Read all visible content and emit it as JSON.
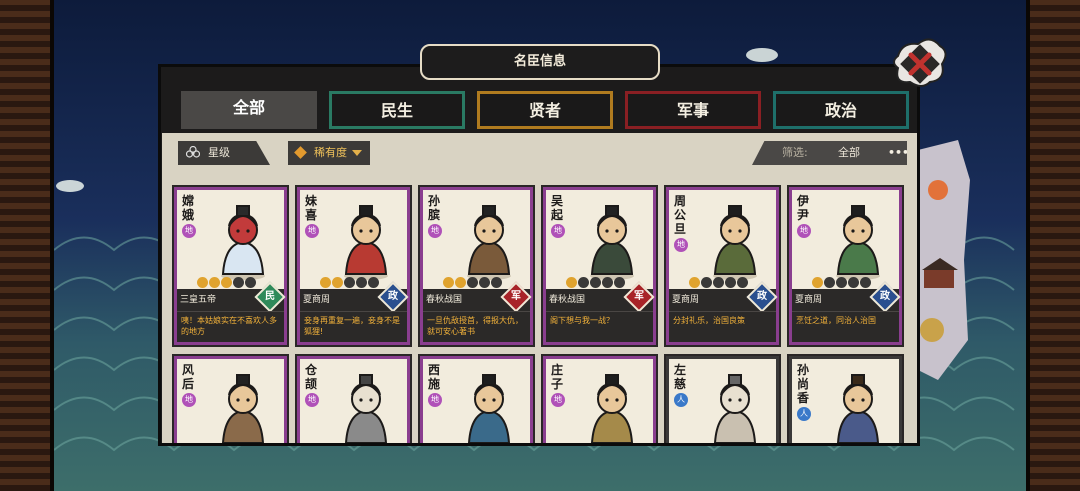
{
  "window": {
    "title": "名臣信息"
  },
  "tabs": [
    {
      "label": "全部",
      "active": true
    },
    {
      "label": "民生",
      "active": false
    },
    {
      "label": "贤者",
      "active": false
    },
    {
      "label": "军事",
      "active": false
    },
    {
      "label": "政治",
      "active": false
    }
  ],
  "filters": {
    "star_label": "星级",
    "rarity_label": "稀有度",
    "screen_label": "筛选:",
    "screen_value": "全部",
    "more": "•••"
  },
  "colors": {
    "minsheng": "#2f8a5a",
    "zhengzhi": "#2a4f8f",
    "junshi": "#a82328",
    "tier_di": "#b051b8",
    "tier_ren": "#3a79c9"
  },
  "cards": [
    {
      "name": "嫦娥",
      "tier": "地",
      "stars": 3,
      "era": "三皇五帝",
      "type": "民",
      "type_color": "#2f8a5a",
      "quote": "咦！本姑娘实在不喜欢人多的地方"
    },
    {
      "name": "妹喜",
      "tier": "地",
      "stars": 2,
      "era": "夏商周",
      "type": "政",
      "type_color": "#2a4f8f",
      "quote": "妾身再重复一遍，妾身不是狐狸!"
    },
    {
      "name": "孙膑",
      "tier": "地",
      "stars": 2,
      "era": "春秋战国",
      "type": "军",
      "type_color": "#a82328",
      "quote": "一旦仇敌授首，得报大仇，就可安心著书"
    },
    {
      "name": "吴起",
      "tier": "地",
      "stars": 1,
      "era": "春秋战国",
      "type": "军",
      "type_color": "#a82328",
      "quote": "阁下想与我一战？"
    },
    {
      "name": "周公旦",
      "tier": "地",
      "stars": 1,
      "era": "夏商周",
      "type": "政",
      "type_color": "#2a4f8f",
      "quote": "分封礼乐，治国良策"
    },
    {
      "name": "伊尹",
      "tier": "地",
      "stars": 1,
      "era": "夏商周",
      "type": "政",
      "type_color": "#2a4f8f",
      "quote": "烹饪之道，同治人治国"
    },
    {
      "name": "风后",
      "tier": "地"
    },
    {
      "name": "仓颉",
      "tier": "地"
    },
    {
      "name": "西施",
      "tier": "地"
    },
    {
      "name": "庄子",
      "tier": "地"
    },
    {
      "name": "左慈",
      "tier": "人"
    },
    {
      "name": "孙尚香",
      "tier": "人"
    }
  ]
}
